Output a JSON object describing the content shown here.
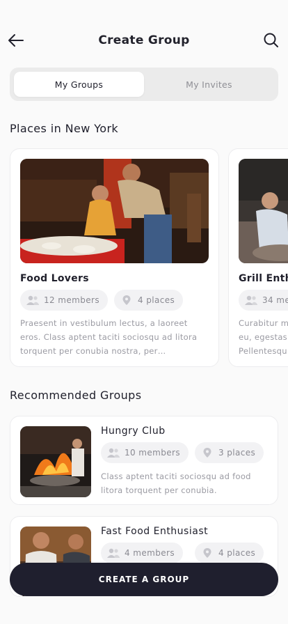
{
  "header": {
    "title": "Create Group",
    "back_icon": "arrow-left-icon",
    "search_icon": "search-icon"
  },
  "tabs": [
    {
      "label": "My Groups",
      "active": true
    },
    {
      "label": "My Invites",
      "active": false
    }
  ],
  "places_section": {
    "title": "Places in New York",
    "cards": [
      {
        "title": "Food Lovers",
        "members": "12 members",
        "places": "4 places",
        "description": "Praesent in vestibulum lectus, a laoreet eros. Class aptent taciti sociosqu ad litora torquent per conubia nostra, per…"
      },
      {
        "title": "Grill Enth",
        "members": "34 me",
        "places": "",
        "description": "Curabitur m\neu, egestas\nPellentesqu"
      }
    ]
  },
  "recommended_section": {
    "title": "Recommended Groups",
    "cards": [
      {
        "title": "Hungry Club",
        "members": "10 members",
        "places": "3 places",
        "description": "Class aptent taciti sociosqu ad food litora torquent per conubia."
      },
      {
        "title": "Fast Food Enthusiast",
        "members": "4 members",
        "places": "4 places",
        "description": ""
      }
    ]
  },
  "cta": {
    "label": "CREATE A GROUP"
  },
  "icons": {
    "members": "people-icon",
    "places": "map-pin-icon"
  },
  "colors": {
    "primary": "#1f1f2e",
    "background": "#fafafa",
    "chip": "#f2f2f4",
    "muted_text": "#9a9aa2"
  }
}
